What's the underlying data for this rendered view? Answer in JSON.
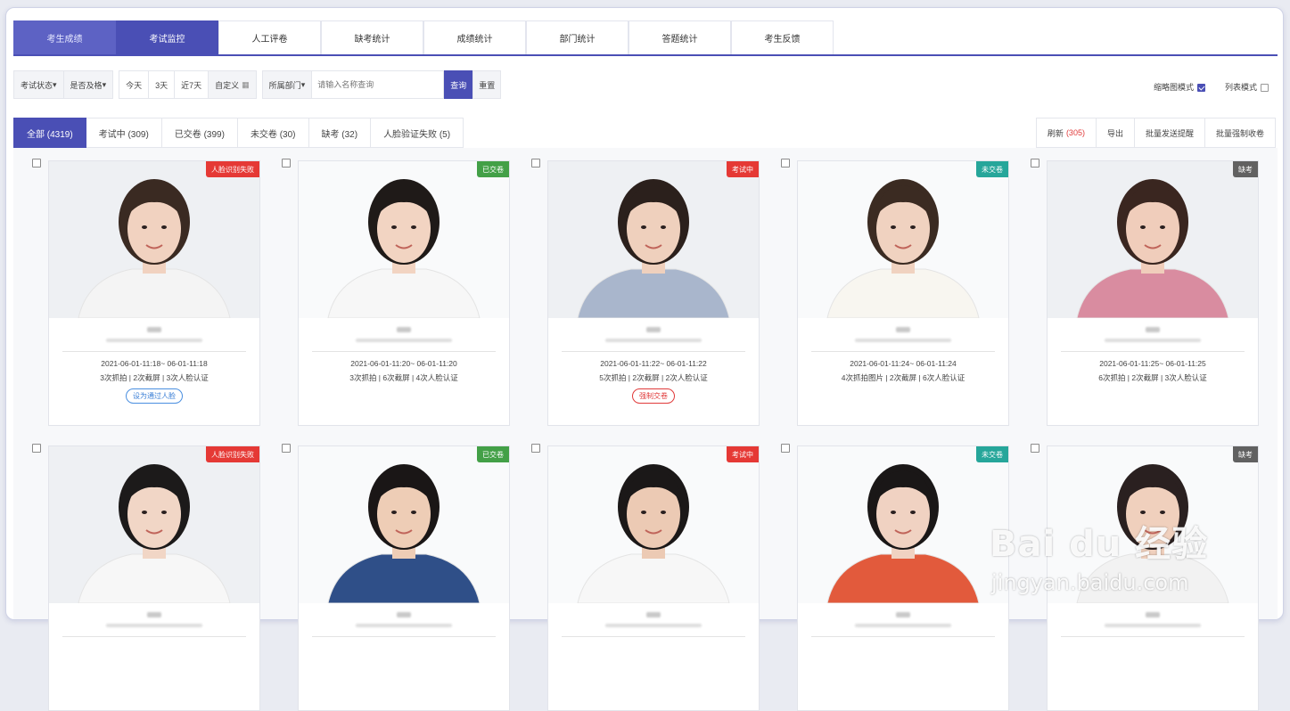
{
  "top_tabs": [
    "考生成绩",
    "考试监控",
    "人工评卷",
    "缺考统计",
    "成绩统计",
    "部门统计",
    "答题统计",
    "考生反馈"
  ],
  "filters": {
    "exam_status": "考试状态",
    "pass_status": "是否及格",
    "today": "今天",
    "three_days": "3天",
    "seven_days": "近7天",
    "custom": "自定义",
    "department": "所属部门",
    "search_placeholder": "请输入名称查询",
    "query": "查询",
    "reset": "重置"
  },
  "modes": {
    "thumbnail": "缩略图模式",
    "list": "列表模式"
  },
  "status_tabs": [
    "全部 (4319)",
    "考试中 (309)",
    "已交卷 (399)",
    "未交卷 (30)",
    "缺考 (32)",
    "人脸验证失败 (5)"
  ],
  "actions": {
    "refresh": "刷新",
    "refresh_count": "(305)",
    "export": "导出",
    "batch_remind": "批量发送提醒",
    "batch_collect": "批量强制收卷"
  },
  "colors": {
    "accent": "#4a4fb5",
    "red": "#e53935",
    "green": "#43a047",
    "teal": "#26a69a",
    "gray": "#616161"
  },
  "cards": [
    {
      "badge": "人脸识别失败",
      "badge_color": "#e53935",
      "time": "2021-06-01-11:18~ 06-01-11:18",
      "stats": "3次抓拍 | 2次截屏 | 3次人脸认证",
      "action": "设为通过人脸",
      "action_style": "blue",
      "hair": "#3a2a22",
      "skin": "#f1d2c0",
      "shirt": "#f4f4f4"
    },
    {
      "badge": "已交卷",
      "badge_color": "#43a047",
      "time": "2021-06-01-11:20~ 06-01-11:20",
      "stats": "3次抓拍 | 6次截屏 | 4次人脸认证",
      "action": "",
      "action_style": "",
      "hair": "#1f1a18",
      "skin": "#f2d4c2",
      "shirt": "#f7f7f7"
    },
    {
      "badge": "考试中",
      "badge_color": "#e53935",
      "time": "2021-06-01-11:22~ 06-01-11:22",
      "stats": "5次抓拍 | 2次截屏 | 2次人脸认证",
      "action": "强制交卷",
      "action_style": "red",
      "hair": "#2b201c",
      "skin": "#efd0bd",
      "shirt": "#a9b6cc"
    },
    {
      "badge": "未交卷",
      "badge_color": "#26a69a",
      "time": "2021-06-01-11:24~ 06-01-11:24",
      "stats": "4次抓拍图片 | 2次截屏 | 6次人脸认证",
      "action": "",
      "action_style": "",
      "hair": "#3b2b22",
      "skin": "#f0d2c0",
      "shirt": "#f8f6f0"
    },
    {
      "badge": "缺考",
      "badge_color": "#616161",
      "time": "2021-06-01-11:25~ 06-01-11:25",
      "stats": "6次抓拍 | 2次截屏 | 3次人脸认证",
      "action": "",
      "action_style": "",
      "hair": "#3a2620",
      "skin": "#f0cdbb",
      "shirt": "#d98ca0"
    },
    {
      "badge": "人脸识别失败",
      "badge_color": "#e53935",
      "time": "",
      "stats": "",
      "action": "",
      "action_style": "",
      "hair": "#1c1a1a",
      "skin": "#f1d6c6",
      "shirt": "#f7f7f7"
    },
    {
      "badge": "已交卷",
      "badge_color": "#43a047",
      "time": "",
      "stats": "",
      "action": "",
      "action_style": "",
      "hair": "#1a1616",
      "skin": "#eecdb6",
      "shirt": "#2f4f88"
    },
    {
      "badge": "考试中",
      "badge_color": "#e53935",
      "time": "",
      "stats": "",
      "action": "",
      "action_style": "",
      "hair": "#1b1818",
      "skin": "#eccab4",
      "shirt": "#f7f7f7"
    },
    {
      "badge": "未交卷",
      "badge_color": "#26a69a",
      "time": "",
      "stats": "",
      "action": "",
      "action_style": "",
      "hair": "#1a1717",
      "skin": "#f0d2c2",
      "shirt": "#e25a3c"
    },
    {
      "badge": "缺考",
      "badge_color": "#616161",
      "time": "",
      "stats": "",
      "action": "",
      "action_style": "",
      "hair": "#2a2020",
      "skin": "#f0d0bd",
      "shirt": "#f2f2f2"
    }
  ],
  "watermark": {
    "brand": "Bai du 经验",
    "url": "jingyan.baidu.com"
  }
}
